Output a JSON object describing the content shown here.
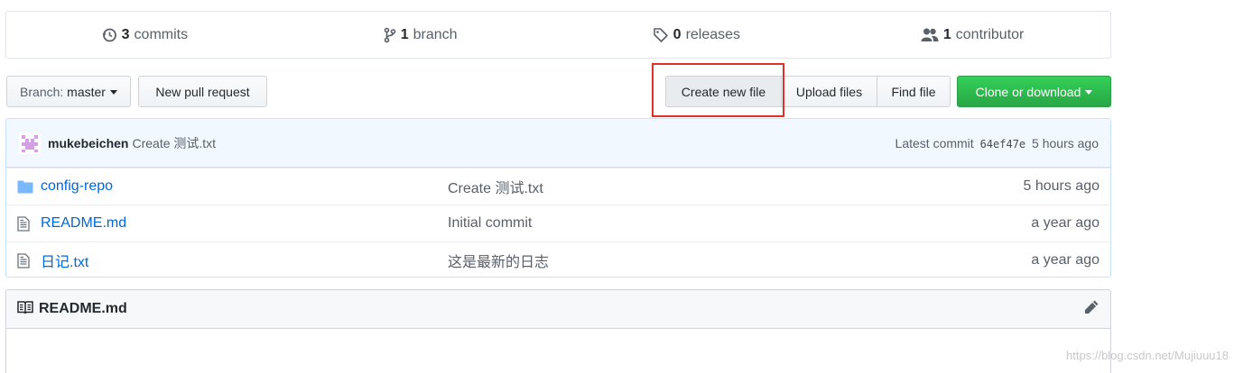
{
  "summary": {
    "commits_count": "3",
    "commits_label": "commits",
    "branch_count": "1",
    "branch_label": "branch",
    "releases_count": "0",
    "releases_label": "releases",
    "contributor_count": "1",
    "contributor_label": "contributor"
  },
  "toolbar": {
    "branch_prefix": "Branch:",
    "branch_name": "master",
    "new_pull_request": "New pull request",
    "create_new_file": "Create new file",
    "upload_files": "Upload files",
    "find_file": "Find file",
    "clone_or_download": "Clone or download"
  },
  "latest_commit": {
    "author": "mukebeichen",
    "message": "Create 测试.txt",
    "prefix": "Latest commit",
    "sha": "64ef47e",
    "age": "5 hours ago"
  },
  "files": [
    {
      "name": "config-repo",
      "type": "directory",
      "icon": "folder-icon",
      "message": "Create 测试.txt",
      "age": "5 hours ago"
    },
    {
      "name": "README.md",
      "type": "file",
      "icon": "file-icon",
      "message": "Initial commit",
      "age": "a year ago"
    },
    {
      "name": "日记.txt",
      "type": "file",
      "icon": "file-icon",
      "message": "这是最新的日志",
      "age": "a year ago"
    }
  ],
  "readme": {
    "title": "README.md"
  },
  "watermark": "https://blog.csdn.net/Mujiuuu18",
  "colors": {
    "accent_blue": "#0366d6",
    "clone_green": "#28a745",
    "highlight_red": "#e0302c"
  }
}
